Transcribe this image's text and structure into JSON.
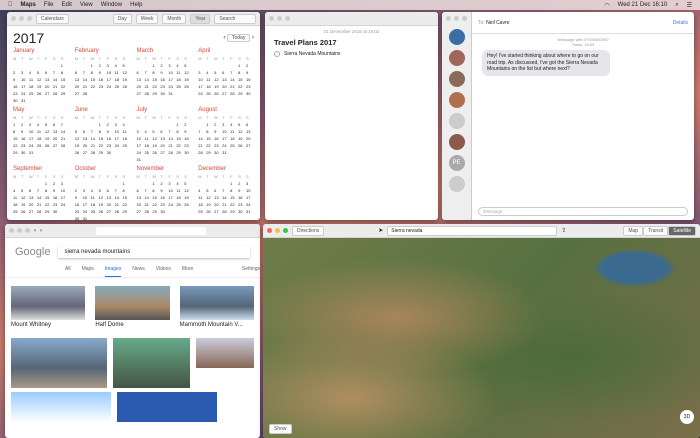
{
  "menubar": {
    "app": "Maps",
    "items": [
      "File",
      "Edit",
      "View",
      "Window",
      "Help"
    ],
    "clock": "Wed 21 Dec 16:10"
  },
  "calendar": {
    "toolbar": {
      "calendars": "Calendars",
      "views": [
        "Day",
        "Week",
        "Month",
        "Year"
      ],
      "search_placeholder": "Search"
    },
    "year": "2017",
    "today": "Today",
    "weekdays": [
      "M",
      "T",
      "W",
      "T",
      "F",
      "S",
      "S"
    ],
    "months": [
      {
        "name": "January",
        "start": 6,
        "days": 31
      },
      {
        "name": "February",
        "start": 2,
        "days": 28
      },
      {
        "name": "March",
        "start": 2,
        "days": 31
      },
      {
        "name": "April",
        "start": 5,
        "days": 30
      },
      {
        "name": "May",
        "start": 0,
        "days": 31
      },
      {
        "name": "June",
        "start": 3,
        "days": 30
      },
      {
        "name": "July",
        "start": 5,
        "days": 31
      },
      {
        "name": "August",
        "start": 1,
        "days": 31
      },
      {
        "name": "September",
        "start": 4,
        "days": 30
      },
      {
        "name": "October",
        "start": 6,
        "days": 31
      },
      {
        "name": "November",
        "start": 2,
        "days": 30
      },
      {
        "name": "December",
        "start": 4,
        "days": 31
      }
    ]
  },
  "notes": {
    "date": "21 December 2016 at 16:02",
    "title": "Travel Plans 2017",
    "items": [
      "Sierra Nevada Mountains"
    ]
  },
  "messages": {
    "to_label": "To:",
    "to": "Neil Cavre",
    "details": "Details",
    "service": "iMessage with 07000000000",
    "time": "Today, 16:09",
    "bubble": "Hey! I've started thinking about where to go on our road trip. As discussed, I've got the Sierra Nevada Mountains on the list but where next?",
    "input_placeholder": "iMessage",
    "contacts": [
      "PE"
    ]
  },
  "safari": {
    "query": "sierra nevada mountains",
    "logo": "Google",
    "tabs": [
      "All",
      "Maps",
      "Images",
      "News",
      "Videos",
      "More"
    ],
    "settings": "Settings",
    "results": [
      "Mount Whitney",
      "Half Dome",
      "Mammoth Mountain V..."
    ]
  },
  "maps": {
    "directions": "Directions",
    "search": "Sierra nevada",
    "modes": [
      "Map",
      "Transit",
      "Satellite"
    ],
    "show": "Show",
    "compass": "3D"
  }
}
